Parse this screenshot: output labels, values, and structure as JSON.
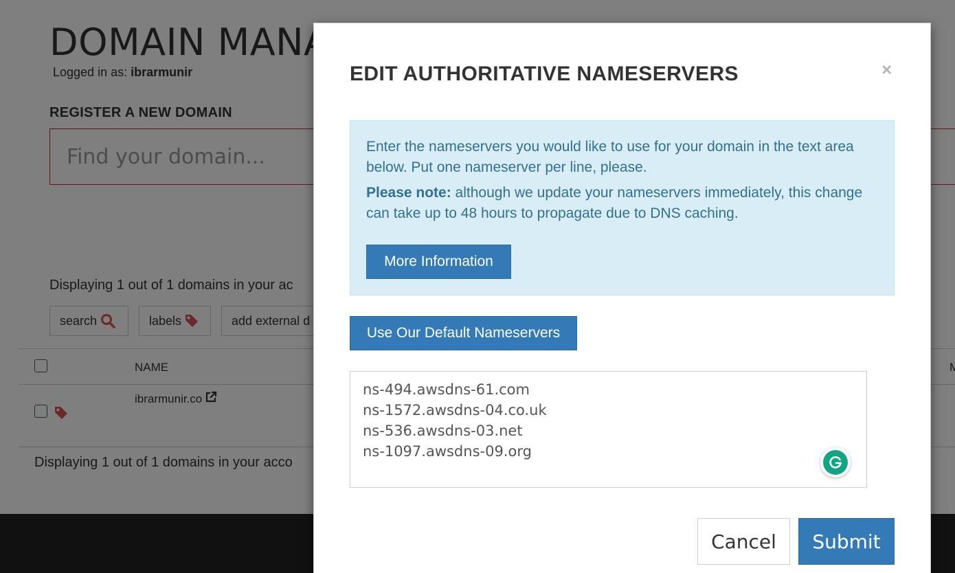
{
  "page": {
    "title": "DOMAIN MANA",
    "logged_in_label": "Logged in as:",
    "username": "ibrarmunir",
    "register_heading": "REGISTER A NEW DOMAIN",
    "search_placeholder": "Find your domain...",
    "displaying_top": "Displaying 1 out of 1 domains in your ac",
    "toolbar": {
      "search_label": "search",
      "labels_label": "labels",
      "add_external_label": "add external d"
    },
    "table": {
      "col_name": "NAME",
      "col_m": "M",
      "rows": [
        {
          "domain": "ibrarmunir.co"
        }
      ]
    },
    "displaying_bottom": "Displaying 1 out of 1 domains in your acco"
  },
  "modal": {
    "title": "EDIT AUTHORITATIVE NAMESERVERS",
    "close_glyph": "×",
    "info_text": "Enter the nameservers you would like to use for your domain in the text area below. Put one nameserver per line, please.",
    "note_label": "Please note:",
    "note_text": " although we update your nameservers immediately, this change can take up to 48 hours to propagate due to DNS caching.",
    "more_info_button": "More Information",
    "default_ns_button": "Use Our Default Nameservers",
    "nameservers": [
      "ns-494.awsdns-61.com",
      "ns-1572.awsdns-04.co.uk",
      "ns-536.awsdns-03.net",
      "ns-1097.awsdns-09.org"
    ],
    "cancel_button": "Cancel",
    "submit_button": "Submit"
  },
  "colors": {
    "primary": "#337ab7",
    "info_bg": "#d9edf7",
    "info_text": "#31708f",
    "danger": "#d9534f",
    "grammarly": "#11a683"
  },
  "icons": {
    "search": "search-icon",
    "labels": "tag-icon",
    "external": "external-link-icon",
    "close": "close-icon",
    "grammarly": "grammarly-icon"
  }
}
